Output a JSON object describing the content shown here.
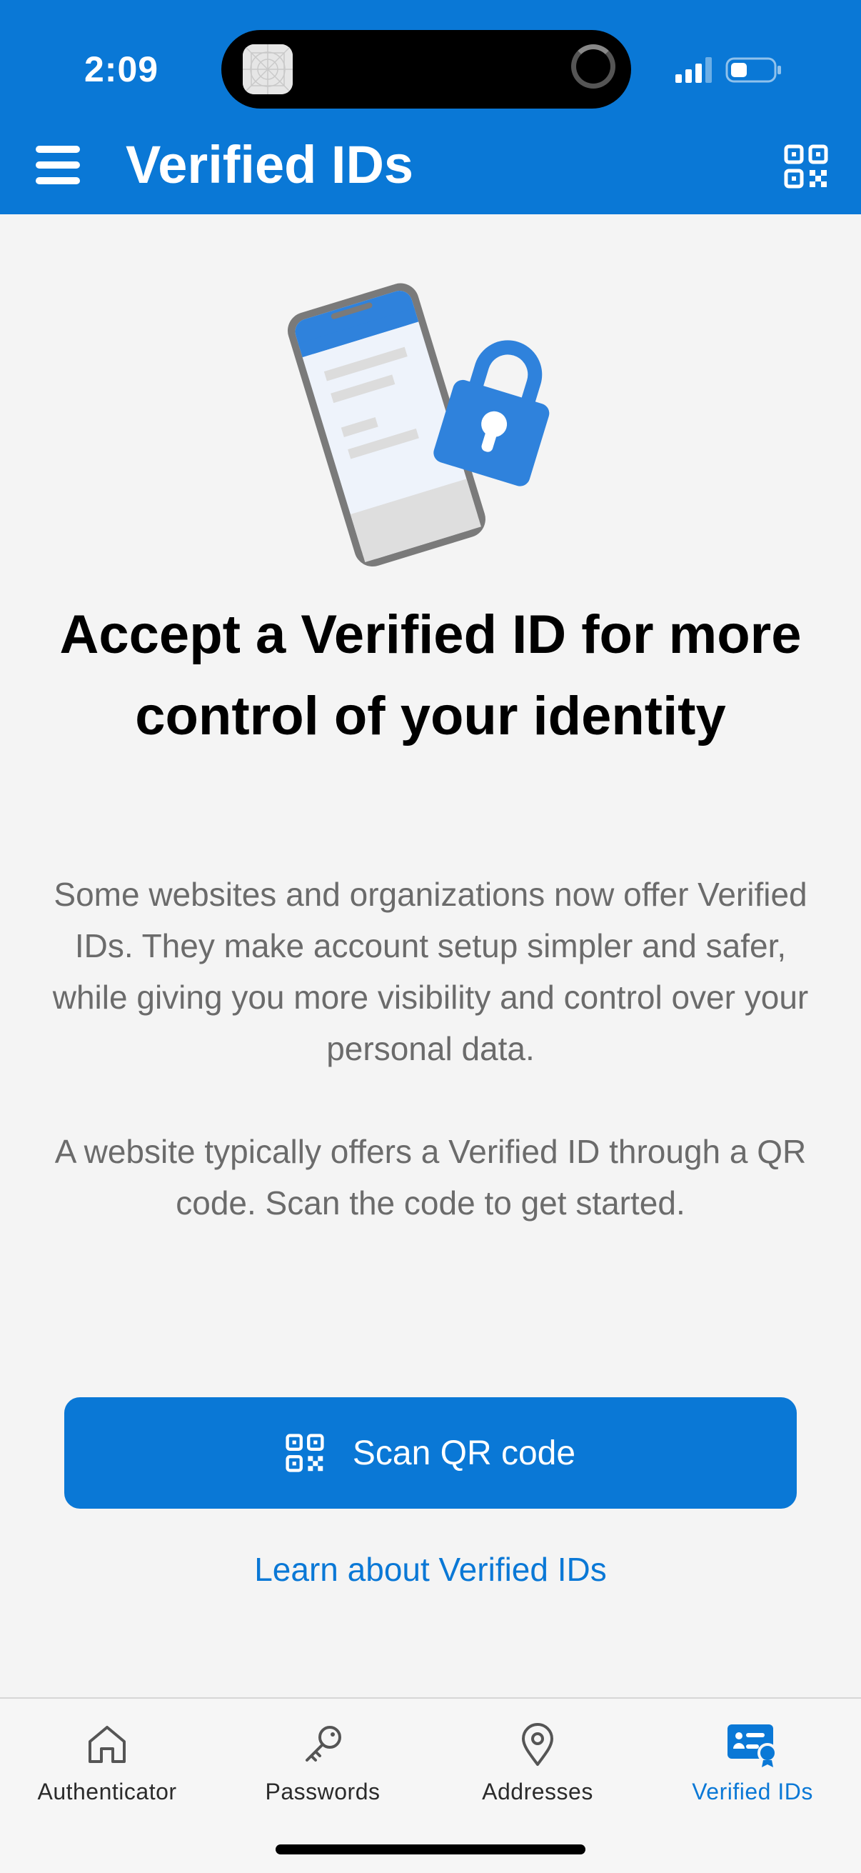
{
  "status_bar": {
    "time": "2:09"
  },
  "header": {
    "title": "Verified IDs",
    "background_color": "#0a78d6",
    "menu_icon": "hamburger-menu-icon",
    "right_icon": "qr-code-icon"
  },
  "main": {
    "illustration": "phone-with-lock-illustration",
    "headline": "Accept a Verified ID for more control of your identity",
    "paragraph1": "Some websites and organizations now offer Verified IDs. They make account setup simpler and safer, while giving you more visibility and control over your personal data.",
    "paragraph2": "A website typically offers a Verified ID through a QR code. Scan the code to get started.",
    "scan_button_label": "Scan QR code",
    "learn_link": "Learn about Verified IDs"
  },
  "tabbar": {
    "tabs": [
      {
        "label": "Authenticator",
        "icon": "home-icon",
        "active": false
      },
      {
        "label": "Passwords",
        "icon": "key-icon",
        "active": false
      },
      {
        "label": "Addresses",
        "icon": "location-pin-icon",
        "active": false
      },
      {
        "label": "Verified IDs",
        "icon": "verified-id-card-icon",
        "active": true
      }
    ],
    "active_color": "#0a78d6"
  }
}
